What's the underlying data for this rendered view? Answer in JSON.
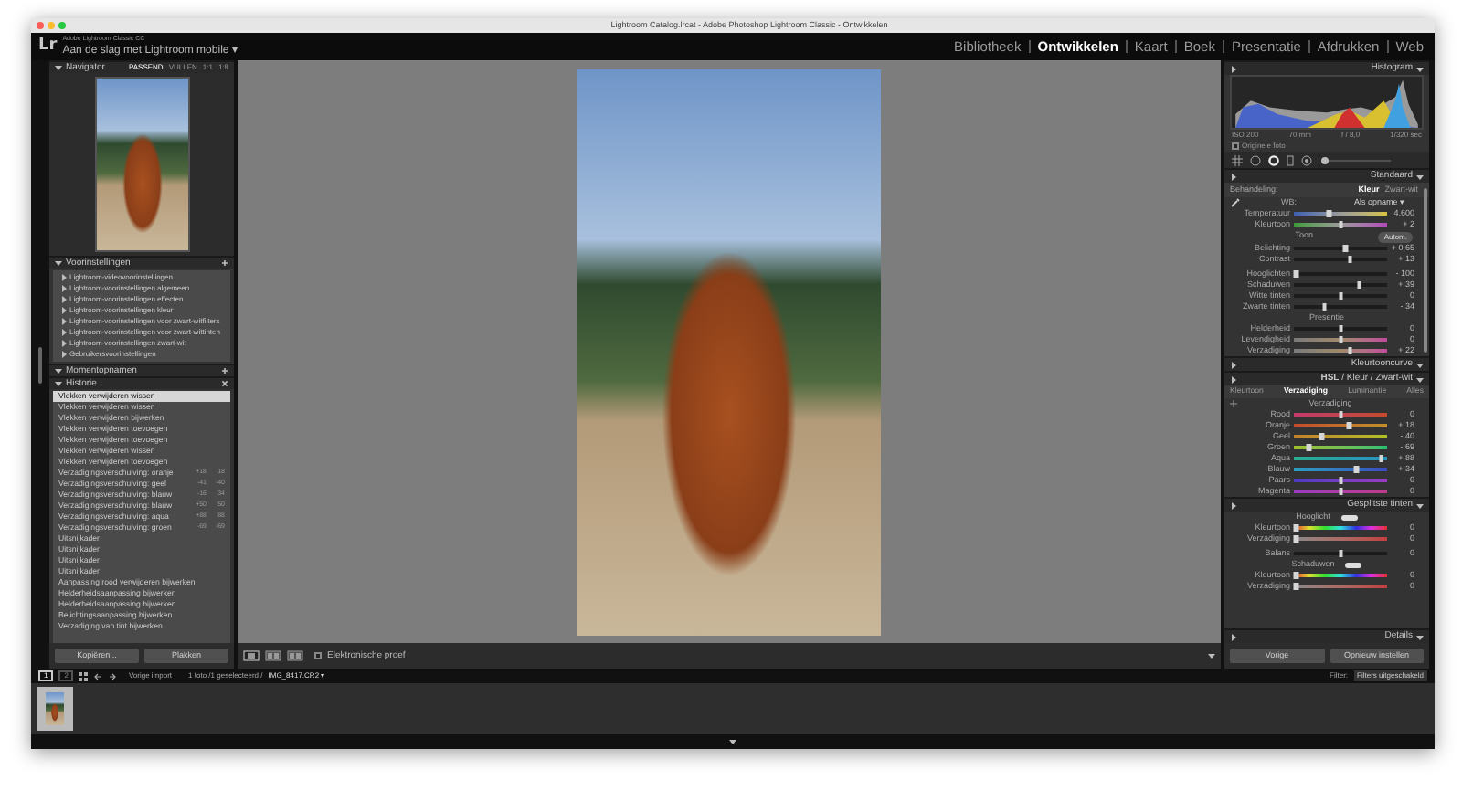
{
  "window": {
    "title": "Lightroom Catalog.lrcat - Adobe Photoshop Lightroom Classic - Ontwikkelen"
  },
  "identity": {
    "logo": "Lr",
    "product": "Adobe Lightroom Classic CC",
    "subtitle": "Aan de slag met Lightroom mobile ▾"
  },
  "modules": [
    {
      "label": "Bibliotheek",
      "selected": false
    },
    {
      "label": "Ontwikkelen",
      "selected": true
    },
    {
      "label": "Kaart",
      "selected": false
    },
    {
      "label": "Boek",
      "selected": false
    },
    {
      "label": "Presentatie",
      "selected": false
    },
    {
      "label": "Afdrukken",
      "selected": false
    },
    {
      "label": "Web",
      "selected": false
    }
  ],
  "left_panel": {
    "navigator": {
      "title": "Navigator",
      "zoom_options": [
        {
          "label": "PASSEND",
          "selected": true
        },
        {
          "label": "VULLEN",
          "selected": false
        },
        {
          "label": "1:1",
          "selected": false
        },
        {
          "label": "1:8",
          "selected": false
        }
      ]
    },
    "presets": {
      "title": "Voorinstellingen",
      "items": [
        "Lightroom-videovoorinstellingen",
        "Lightroom-voorinstellingen algemeen",
        "Lightroom-voorinstellingen effecten",
        "Lightroom-voorinstellingen kleur",
        "Lightroom-voorinstellingen voor zwart-witfilters",
        "Lightroom-voorinstellingen voor zwart-wittinten",
        "Lightroom-voorinstellingen zwart-wit",
        "Gebruikersvoorinstellingen"
      ]
    },
    "snapshots": {
      "title": "Momentopnamen"
    },
    "history": {
      "title": "Historie",
      "items": [
        {
          "label": "Vlekken verwijderen wissen",
          "selected": true
        },
        {
          "label": "Vlekken verwijderen wissen",
          "selected": false
        },
        {
          "label": "Vlekken verwijderen bijwerken",
          "selected": false
        },
        {
          "label": "Vlekken verwijderen toevoegen",
          "selected": false
        },
        {
          "label": "Vlekken verwijderen toevoegen",
          "selected": false
        },
        {
          "label": "Vlekken verwijderen wissen",
          "selected": false
        },
        {
          "label": "Vlekken verwijderen toevoegen",
          "selected": false
        },
        {
          "label": "Verzadigingsverschuiving: oranje",
          "selected": false,
          "change": "+18",
          "value": "18"
        },
        {
          "label": "Verzadigingsverschuiving: geel",
          "selected": false,
          "change": "-41",
          "value": "-40"
        },
        {
          "label": "Verzadigingsverschuiving: blauw",
          "selected": false,
          "change": "-16",
          "value": "34"
        },
        {
          "label": "Verzadigingsverschuiving: blauw",
          "selected": false,
          "change": "+50",
          "value": "50"
        },
        {
          "label": "Verzadigingsverschuiving: aqua",
          "selected": false,
          "change": "+88",
          "value": "88"
        },
        {
          "label": "Verzadigingsverschuiving: groen",
          "selected": false,
          "change": "-69",
          "value": "-69"
        },
        {
          "label": "Uitsnijkader",
          "selected": false
        },
        {
          "label": "Uitsnijkader",
          "selected": false
        },
        {
          "label": "Uitsnijkader",
          "selected": false
        },
        {
          "label": "Uitsnijkader",
          "selected": false
        },
        {
          "label": "Aanpassing rood verwijderen bijwerken",
          "selected": false
        },
        {
          "label": "Helderheidsaanpassing bijwerken",
          "selected": false
        },
        {
          "label": "Helderheidsaanpassing bijwerken",
          "selected": false
        },
        {
          "label": "Belichtingsaanpassing bijwerken",
          "selected": false
        },
        {
          "label": "Verzadiging van tint bijwerken",
          "selected": false
        }
      ]
    },
    "buttons": [
      "Kopiëren...",
      "Plakken"
    ]
  },
  "toolbar": {
    "proof": {
      "label": "Elektronische proef",
      "checked": false
    }
  },
  "right_panel": {
    "histogram": {
      "title": "Histogram",
      "info": [
        "ISO 200",
        "70 mm",
        "f / 8,0",
        "1/320 sec"
      ],
      "original_photo": {
        "label": "Originele foto",
        "checked": false
      }
    },
    "basic": {
      "title": "Standaard",
      "treatment_label": "Behandeling:",
      "treatment": [
        {
          "label": "Kleur",
          "selected": true
        },
        {
          "label": "Zwart-wit",
          "selected": false
        }
      ],
      "wb_label": "WB:",
      "wb_value": "Als opname ▾",
      "wb_sliders": [
        {
          "name": "Temperatuur",
          "kind": "temperature",
          "level": 0.38,
          "reading": "4.600"
        },
        {
          "name": "Kleurtoon",
          "kind": "tint",
          "level": 0.5,
          "reading": "+ 2"
        }
      ],
      "tone_label": "Toon",
      "auto": "Autom.",
      "tone_sliders": [
        {
          "name": "Belichting",
          "kind": "plain",
          "level": 0.55,
          "reading": "+ 0,65"
        },
        {
          "name": "Contrast",
          "kind": "plain",
          "level": 0.6,
          "reading": "+ 13"
        }
      ],
      "tone_sliders_2": [
        {
          "name": "Hooglichten",
          "kind": "plain",
          "level": 0.02,
          "reading": "- 100"
        },
        {
          "name": "Schaduwen",
          "kind": "plain",
          "level": 0.7,
          "reading": "+ 39"
        },
        {
          "name": "Witte tinten",
          "kind": "plain",
          "level": 0.5,
          "reading": "0"
        },
        {
          "name": "Zwarte tinten",
          "kind": "plain",
          "level": 0.33,
          "reading": "- 34"
        }
      ],
      "presence_label": "Presentie",
      "presence_sliders": [
        {
          "name": "Helderheid",
          "kind": "plain",
          "level": 0.5,
          "reading": "0"
        },
        {
          "name": "Levendigheid",
          "kind": "vibrance",
          "level": 0.5,
          "reading": "0"
        },
        {
          "name": "Verzadiging",
          "kind": "vibrance",
          "level": 0.6,
          "reading": "+ 22"
        }
      ]
    },
    "tone_curve": {
      "title": "Kleurtooncurve"
    },
    "hsl": {
      "title": "**HSL** / Kleur / Zwart-wit",
      "tabs": [
        {
          "label": "Kleurtoon",
          "selected": false
        },
        {
          "label": "Verzadiging",
          "selected": true
        },
        {
          "label": "Luminantie",
          "selected": false
        },
        {
          "label": "Alles",
          "selected": false
        }
      ],
      "section": "Verzadiging",
      "sliders": [
        {
          "name": "Rood",
          "kind": "red",
          "level": 0.5,
          "reading": "0"
        },
        {
          "name": "Oranje",
          "kind": "orange",
          "level": 0.59,
          "reading": "+ 18"
        },
        {
          "name": "Geel",
          "kind": "yellow",
          "level": 0.3,
          "reading": "- 40"
        },
        {
          "name": "Groen",
          "kind": "green",
          "level": 0.16,
          "reading": "- 69"
        },
        {
          "name": "Aqua",
          "kind": "aqua",
          "level": 0.94,
          "reading": "+ 88"
        },
        {
          "name": "Blauw",
          "kind": "blue",
          "level": 0.67,
          "reading": "+ 34"
        },
        {
          "name": "Paars",
          "kind": "purple",
          "level": 0.5,
          "reading": "0"
        },
        {
          "name": "Magenta",
          "kind": "magenta",
          "level": 0.5,
          "reading": "0"
        }
      ]
    },
    "split_toning": {
      "title": "Gesplitste tinten",
      "highlights": {
        "label": "Hooglicht",
        "sliders": [
          {
            "name": "Kleurtoon",
            "kind": "hue",
            "level": 0.02,
            "reading": "0"
          },
          {
            "name": "Verzadiging",
            "kind": "saturation",
            "level": 0.02,
            "reading": "0"
          }
        ]
      },
      "balance": {
        "name": "Balans",
        "kind": "plain",
        "level": 0.5,
        "reading": "0"
      },
      "shadows": {
        "label": "Schaduwen",
        "sliders": [
          {
            "name": "Kleurtoon",
            "kind": "hue",
            "level": 0.02,
            "reading": "0"
          },
          {
            "name": "Verzadiging",
            "kind": "saturation",
            "level": 0.02,
            "reading": "0"
          }
        ]
      }
    },
    "details": {
      "title": "Details"
    },
    "buttons": [
      "Vorige",
      "Opnieuw instellen"
    ]
  },
  "filmstrip": {
    "pages": [
      {
        "label": "1",
        "selected": true
      },
      {
        "label": "2",
        "selected": false
      }
    ],
    "source": "Vorige import",
    "info": "1 foto /1 geselecteerd /",
    "filename": "IMG_8417.CR2 ▾",
    "filter_label": "Filter:",
    "filter_value": "Filters uitgeschakeld"
  }
}
